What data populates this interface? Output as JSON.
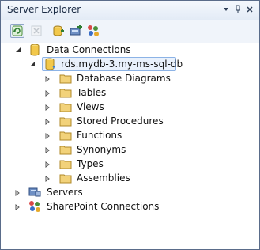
{
  "window": {
    "title": "Server Explorer",
    "controls": {
      "pin": "▾",
      "autohide": "📌",
      "close": "×"
    }
  },
  "toolbar": {
    "buttons": [
      {
        "name": "refresh",
        "icon": "refresh-icon"
      },
      {
        "name": "stop",
        "icon": "stop-icon"
      },
      {
        "name": "connect-database",
        "icon": "connect-database-icon"
      },
      {
        "name": "connect-server",
        "icon": "connect-server-icon"
      },
      {
        "name": "connect-sharepoint",
        "icon": "connect-sharepoint-icon"
      }
    ]
  },
  "tree": {
    "data_connections": {
      "label": "Data Connections",
      "connection": {
        "label": "rds.mydb-3.my-ms-sql-db",
        "children": [
          "Database Diagrams",
          "Tables",
          "Views",
          "Stored Procedures",
          "Functions",
          "Synonyms",
          "Types",
          "Assemblies"
        ]
      }
    },
    "servers": {
      "label": "Servers"
    },
    "sharepoint": {
      "label": "SharePoint Connections"
    }
  },
  "colors": {
    "title_bg": "#eaf0f8",
    "selection_border": "#8cb3e6",
    "folder": "#f2d27a"
  }
}
